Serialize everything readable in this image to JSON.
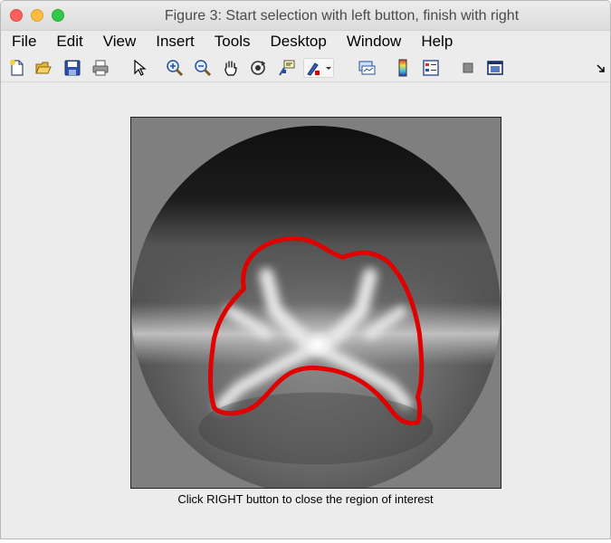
{
  "window": {
    "title": "Figure 3: Start selection with left button, finish with right"
  },
  "menu": {
    "items": [
      "File",
      "Edit",
      "View",
      "Insert",
      "Tools",
      "Desktop",
      "Window",
      "Help"
    ]
  },
  "toolbar": {
    "icons": [
      "new-figure-icon",
      "open-file-icon",
      "save-icon",
      "print-icon",
      "pointer-icon",
      "zoom-in-icon",
      "zoom-out-icon",
      "pan-hand-icon",
      "rotate-3d-icon",
      "data-cursor-icon",
      "brush-icon",
      "link-plot-icon",
      "colorbar-icon",
      "legend-icon",
      "hide-plot-tools-icon",
      "show-plot-tools-icon",
      "dock-arrow-icon"
    ]
  },
  "figure": {
    "status_text": "Click RIGHT button to close the region of interest",
    "roi_color": "#e00000"
  }
}
